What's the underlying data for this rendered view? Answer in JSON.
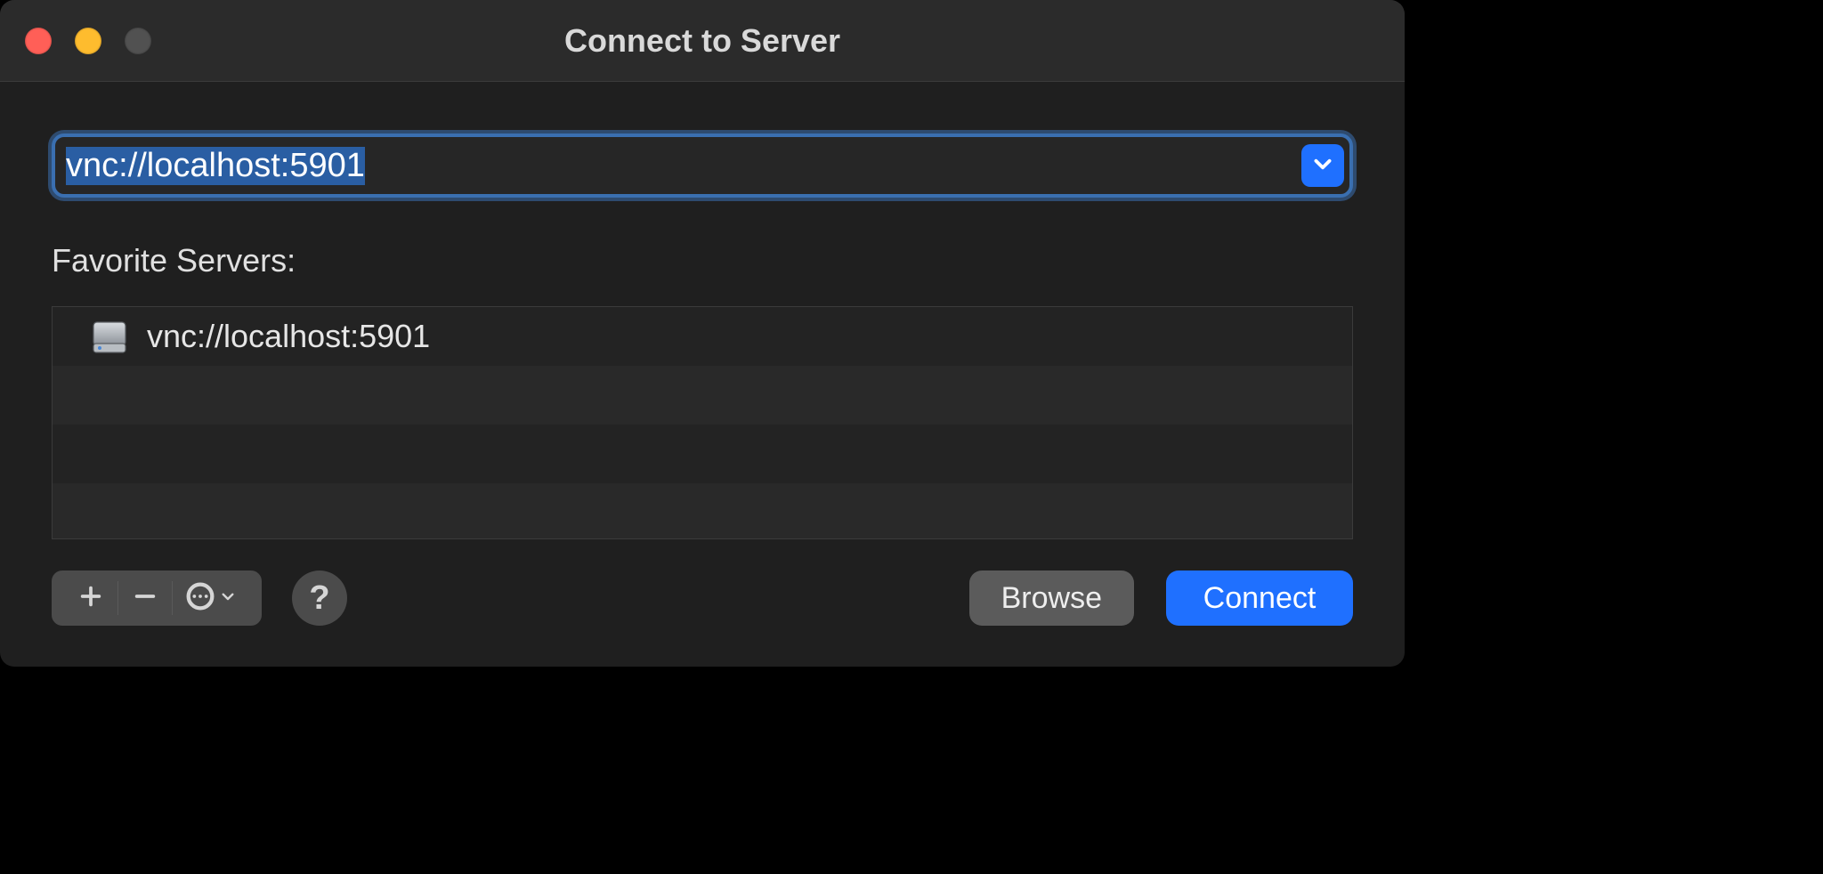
{
  "window": {
    "title": "Connect to Server"
  },
  "address": {
    "value": "vnc://localhost:5901"
  },
  "favorites": {
    "label": "Favorite Servers:",
    "items": [
      {
        "address": "vnc://localhost:5901"
      }
    ]
  },
  "buttons": {
    "browse": "Browse",
    "connect": "Connect",
    "help": "?"
  },
  "icons": {
    "add": "plus-icon",
    "remove": "minus-icon",
    "more": "ellipsis-icon",
    "dropdown": "chevron-down-icon",
    "server": "server-drive-icon"
  }
}
